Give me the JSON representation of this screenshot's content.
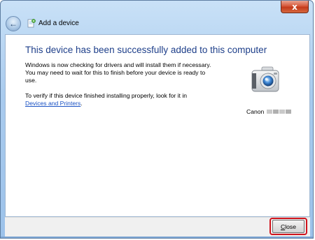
{
  "window": {
    "close_glyph": "x",
    "title": "Add a device",
    "back_glyph": "←"
  },
  "main": {
    "heading": "This device has been successfully added to this computer",
    "message": "Windows is now checking for drivers and will install them if necessary. You may need to wait for this to finish before your device is ready to use.",
    "verify_text": "To verify if this device finished installing properly, look for it in",
    "link_text": "Devices and Printers",
    "link_suffix": "."
  },
  "device": {
    "name": "Canon",
    "icon": "camera-icon"
  },
  "footer": {
    "close_label_underlined": "C",
    "close_label_rest": "lose"
  },
  "colors": {
    "heading": "#1e3f8a",
    "link": "#1a52c4",
    "highlight": "#d0141d",
    "titlebar": "#a9cbee"
  }
}
